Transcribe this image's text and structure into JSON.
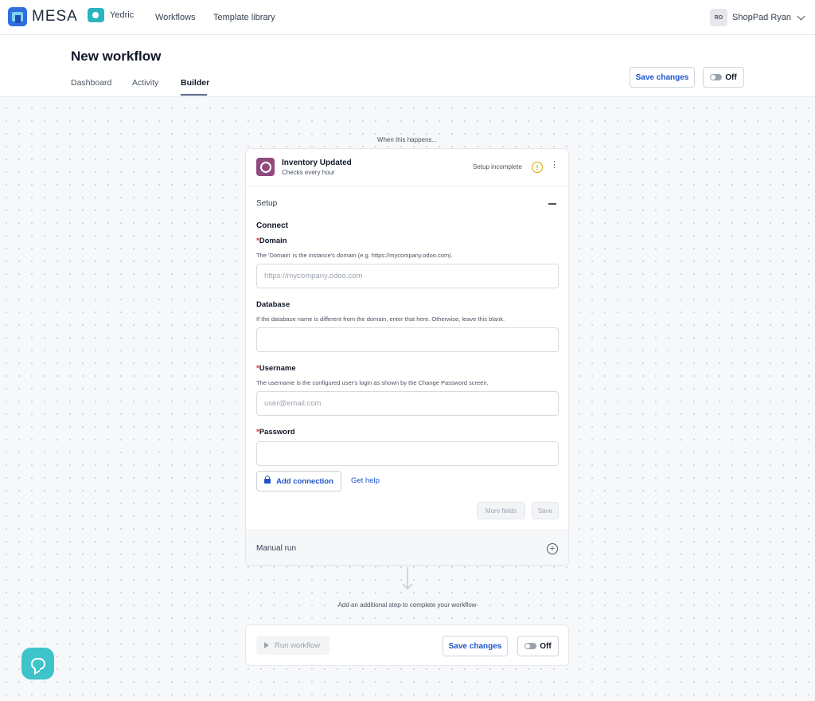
{
  "topnav": {
    "logo_text": "MESA",
    "shop_name": "Yedric",
    "links": [
      "Workflows",
      "Template library"
    ],
    "user_initials": "RO",
    "user_name": "ShopPad Ryan"
  },
  "header": {
    "title": "New workflow",
    "tabs": [
      "Dashboard",
      "Activity",
      "Builder"
    ],
    "active_tab": "Builder",
    "save_label": "Save changes",
    "toggle_label": "Off"
  },
  "trigger": {
    "when_label": "When this happens...",
    "title": "Inventory Updated",
    "subtitle": "Checks every hour",
    "status": "Setup incomplete",
    "warning_glyph": "!",
    "menu_glyph": "⋮"
  },
  "setup": {
    "section_label": "Setup",
    "connect_title": "Connect",
    "fields": {
      "domain": {
        "required_mark": "*",
        "label": "Domain",
        "help": "The 'Domain' is the instance's domain (e.g. https://mycompany.odoo.com).",
        "placeholder": "https://mycompany.odoo.com",
        "value": ""
      },
      "database": {
        "label": "Database",
        "help": "If the database name is different from the domain, enter that here. Otherwise, leave this blank.",
        "placeholder": "",
        "value": ""
      },
      "username": {
        "required_mark": "*",
        "label": "Username",
        "help": "The username is the configured user's login as shown by the Change Password screen.",
        "placeholder": "user@email.com",
        "value": ""
      },
      "password": {
        "required_mark": "*",
        "label": "Password",
        "placeholder": "",
        "value": ""
      }
    },
    "add_connection_label": "Add connection",
    "get_help_label": "Get help",
    "more_fields_label": "More fields",
    "save_label": "Save"
  },
  "manual_run": {
    "label": "Manual run",
    "add_glyph": "+"
  },
  "add_step_text": "Add an additional step to complete your workflow",
  "footer": {
    "run_label": "Run workflow",
    "save_label": "Save changes",
    "toggle_label": "Off"
  },
  "colors": {
    "accent_blue": "#1f54c9",
    "chat_teal": "#3fc3cb",
    "warning": "#e2a200",
    "odoo_purple": "#8f4a7e"
  },
  "icons": [
    "mesa-logo-icon",
    "shop-logo-icon",
    "chevron-down-icon",
    "odoo-icon",
    "warning-icon",
    "kebab-menu-icon",
    "collapse-icon",
    "lock-icon",
    "add-circle-icon",
    "arrow-down-icon",
    "play-icon",
    "chat-icon"
  ]
}
